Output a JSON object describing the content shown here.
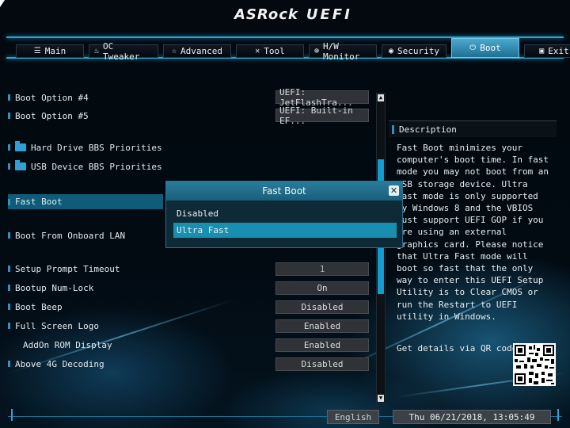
{
  "header": {
    "brand": "ASRock",
    "product": "UEFI"
  },
  "tabs": [
    {
      "label": "Main",
      "icon": "list-icon"
    },
    {
      "label": "OC Tweaker",
      "icon": "flame-icon"
    },
    {
      "label": "Advanced",
      "icon": "star-icon"
    },
    {
      "label": "Tool",
      "icon": "tools-icon"
    },
    {
      "label": "H/W Monitor",
      "icon": "globe-icon"
    },
    {
      "label": "Security",
      "icon": "shield-icon"
    },
    {
      "label": "Boot",
      "icon": "power-icon"
    },
    {
      "label": "Exit",
      "icon": "exit-icon"
    }
  ],
  "active_tab": "Boot",
  "settings": [
    {
      "label": "Boot Option #4",
      "value": "UEFI: JetFlashTra..."
    },
    {
      "label": "Boot Option #5",
      "value": "UEFI: Built-in EF..."
    },
    {
      "label": "Hard Drive BBS Priorities"
    },
    {
      "label": "USB Device BBS Priorities"
    },
    {
      "label": "Fast Boot"
    },
    {
      "label": "Boot From Onboard LAN"
    },
    {
      "label": "Setup Prompt Timeout",
      "value": "1"
    },
    {
      "label": "Bootup Num-Lock",
      "value": "On"
    },
    {
      "label": "Boot Beep",
      "value": "Disabled"
    },
    {
      "label": "Full Screen Logo",
      "value": "Enabled"
    },
    {
      "label": "AddOn ROM Display",
      "value": "Enabled"
    },
    {
      "label": "Above 4G Decoding",
      "value": "Disabled"
    }
  ],
  "description": {
    "title": "Description",
    "text": "Fast Boot minimizes your computer's boot time. In fast mode you may not boot from an USB storage device. Ultra Fast mode is only supported by Windows 8 and the VBIOS must support UEFI GOP if you are using an external graphics card. Please notice that Ultra Fast mode will boot so fast that the only way to enter this UEFI Setup Utility is to Clear CMOS or run the Restart to UEFI utility in Windows.",
    "qr_label": "Get details via QR code"
  },
  "modal": {
    "title": "Fast Boot",
    "options": [
      "Disabled",
      "Ultra Fast"
    ],
    "selected": "Ultra Fast"
  },
  "footer": {
    "language": "English",
    "datetime": "Thu 06/21/2018, 13:05:49"
  },
  "colors": {
    "accent": "#2aa6d6",
    "selection": "#188fb1",
    "highlight_row": "#0f5c7a",
    "scroll_thumb": "#159bd0"
  }
}
